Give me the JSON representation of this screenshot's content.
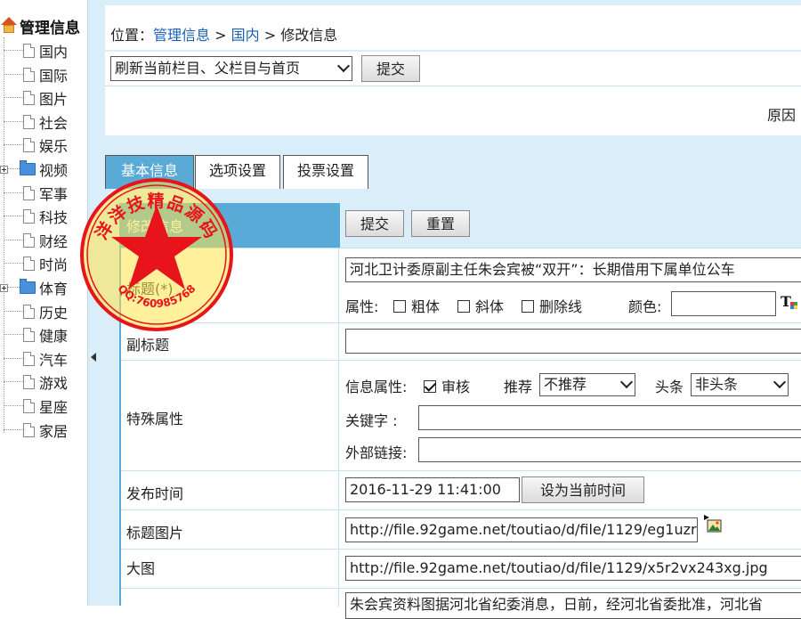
{
  "tree": {
    "root_label": "管理信息",
    "items": [
      {
        "label": "国内",
        "type": "doc"
      },
      {
        "label": "国际",
        "type": "doc"
      },
      {
        "label": "图片",
        "type": "doc"
      },
      {
        "label": "社会",
        "type": "doc"
      },
      {
        "label": "娱乐",
        "type": "doc"
      },
      {
        "label": "视频",
        "type": "folder"
      },
      {
        "label": "军事",
        "type": "doc"
      },
      {
        "label": "科技",
        "type": "doc"
      },
      {
        "label": "财经",
        "type": "doc"
      },
      {
        "label": "时尚",
        "type": "doc"
      },
      {
        "label": "体育",
        "type": "folder"
      },
      {
        "label": "历史",
        "type": "doc"
      },
      {
        "label": "健康",
        "type": "doc"
      },
      {
        "label": "汽车",
        "type": "doc"
      },
      {
        "label": "游戏",
        "type": "doc"
      },
      {
        "label": "星座",
        "type": "doc"
      },
      {
        "label": "家居",
        "type": "doc"
      }
    ]
  },
  "location": {
    "prefix": "位置：",
    "crumb1": "管理信息",
    "sep1": " > ",
    "crumb2": "国内",
    "sep2": " > ",
    "current": "修改信息"
  },
  "refresh": {
    "select_value": "刷新当前栏目、父栏目与首页",
    "submit_label": "提交",
    "reason_text": "原因"
  },
  "tabs": [
    {
      "label": "基本信息",
      "active": true
    },
    {
      "label": "选项设置",
      "active": false
    },
    {
      "label": "投票设置",
      "active": false
    }
  ],
  "form": {
    "header_label": "修改信息",
    "submit_label": "提交",
    "reset_label": "重置",
    "title": {
      "label": "标题(*)",
      "value": "河北卫计委原副主任朱会宾被“双开”：长期借用下属单位公车",
      "attr_label": "属性:",
      "bold_label": "粗体",
      "italic_label": "斜体",
      "strike_label": "删除线",
      "color_label": "颜色:"
    },
    "subtitle": {
      "label": "副标题",
      "value": ""
    },
    "special": {
      "label": "特殊属性",
      "info_attr_label": "信息属性:",
      "audit_label": "审核",
      "recommend_label": "推荐",
      "recommend_value": "不推荐",
      "headline_label": "头条",
      "headline_value": "非头条",
      "keyword_label": "关键字  :",
      "keyword_value": "",
      "link_label": "外部链接:",
      "link_value": ""
    },
    "publish": {
      "label": "发布时间",
      "value": "2016-11-29 11:41:00",
      "set_now_label": "设为当前时间"
    },
    "title_pic": {
      "label": "标题图片",
      "value": "http://file.92game.net/toutiao/d/file/1129/eg1uzr"
    },
    "big_pic": {
      "label": "大图",
      "value": "http://file.92game.net/toutiao/d/file/1129/x5r2vx243xg.jpg"
    },
    "summary": {
      "value": "朱会宾资料图据河北省纪委消息，日前，经河北省委批准，河北省"
    }
  },
  "stamp": {
    "top_text": "洋洋技精品源码",
    "bottom_text": "QQ:760985768"
  },
  "colors": {
    "accent": "#5aaad8",
    "bg_light": "#d9eef8",
    "link": "#1a5fb4",
    "stamp_red": "#e8141b",
    "stamp_yellow": "#ffe44a"
  }
}
